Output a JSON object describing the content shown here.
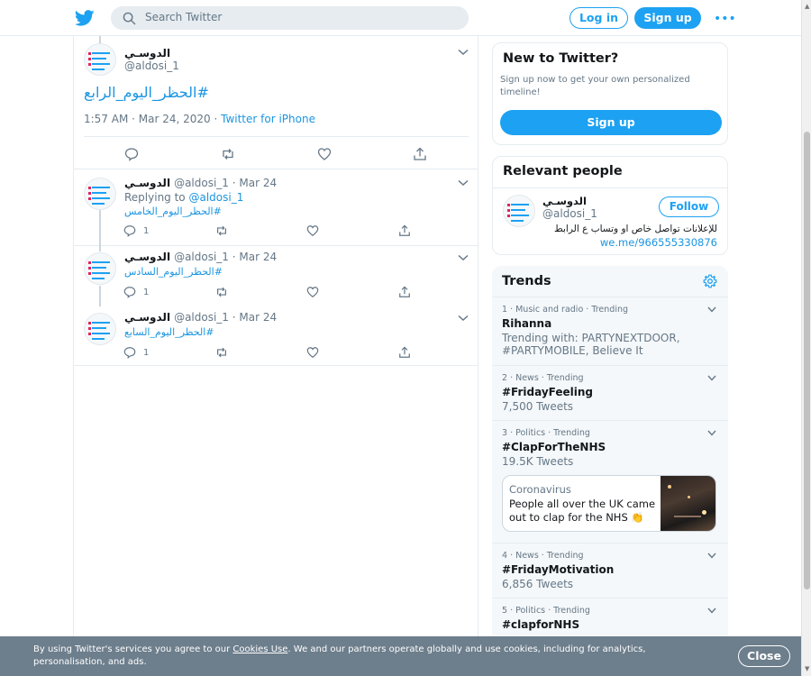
{
  "header": {
    "search_placeholder": "Search Twitter",
    "login_label": "Log in",
    "signup_label": "Sign up",
    "more_label": "•••"
  },
  "main_tweet": {
    "name": "الدوسـي",
    "handle": "@aldosi_1",
    "text": "#الحظر_اليوم_الرابع",
    "time": "1:57 AM · Mar 24, 2020 · ",
    "source": "Twitter for iPhone"
  },
  "replies": [
    {
      "name": "الدوسـي",
      "handle_date": "@aldosi_1 · Mar 24",
      "replying_prefix": "Replying to ",
      "replying_handle": "@aldosi_1",
      "hashtag": "#الحظر_اليوم_الخامس",
      "reply_count": "1"
    },
    {
      "name": "الدوسـي",
      "handle_date": "@aldosi_1 · Mar 24",
      "hashtag": "#الحظر_اليوم_السادس",
      "reply_count": "1"
    },
    {
      "name": "الدوسـي",
      "handle_date": "@aldosi_1 · Mar 24",
      "hashtag": "#الحظر_اليوم_السابع",
      "reply_count": "1"
    }
  ],
  "new_to_twitter": {
    "title": "New to Twitter?",
    "subtitle": "Sign up now to get your own personalized timeline!",
    "button": "Sign up"
  },
  "relevant_people": {
    "title": "Relevant people",
    "name": "الدوسـي",
    "handle": "@aldosi_1",
    "follow": "Follow",
    "bio": "للإعلانات تواصل خاص او وتساب ع الرابط",
    "bio_link": "we.me/966555330876"
  },
  "trends": {
    "title": "Trends",
    "items": [
      {
        "context": "1 · Music and radio · Trending",
        "name": "Rihanna",
        "sub": "Trending with: PARTYNEXTDOOR, #PARTYMOBILE, Believe It"
      },
      {
        "context": "2 · News · Trending",
        "name": "#FridayFeeling",
        "sub": "7,500 Tweets"
      },
      {
        "context": "3 · Politics · Trending",
        "name": "#ClapForTheNHS",
        "sub": "19.5K Tweets"
      },
      {
        "context": "4 · News · Trending",
        "name": "#FridayMotivation",
        "sub": "6,856 Tweets"
      },
      {
        "context": "5 · Politics · Trending",
        "name": "#clapforNHS",
        "sub": ""
      }
    ],
    "news_card": {
      "label": "Coronavirus",
      "text": "People all over the UK came out to clap for the NHS 👏"
    }
  },
  "cookie_banner": {
    "text_before": "By using Twitter's services you agree to our ",
    "link": "Cookies Use",
    "text_after": ". We and our partners operate globally and use cookies, including for analytics, personalisation, and ads.",
    "close": "Close"
  },
  "colors": {
    "brand": "#1da1f2",
    "link": "#1b95e0",
    "secondary_text": "#657786",
    "border": "#e6ecf0"
  }
}
